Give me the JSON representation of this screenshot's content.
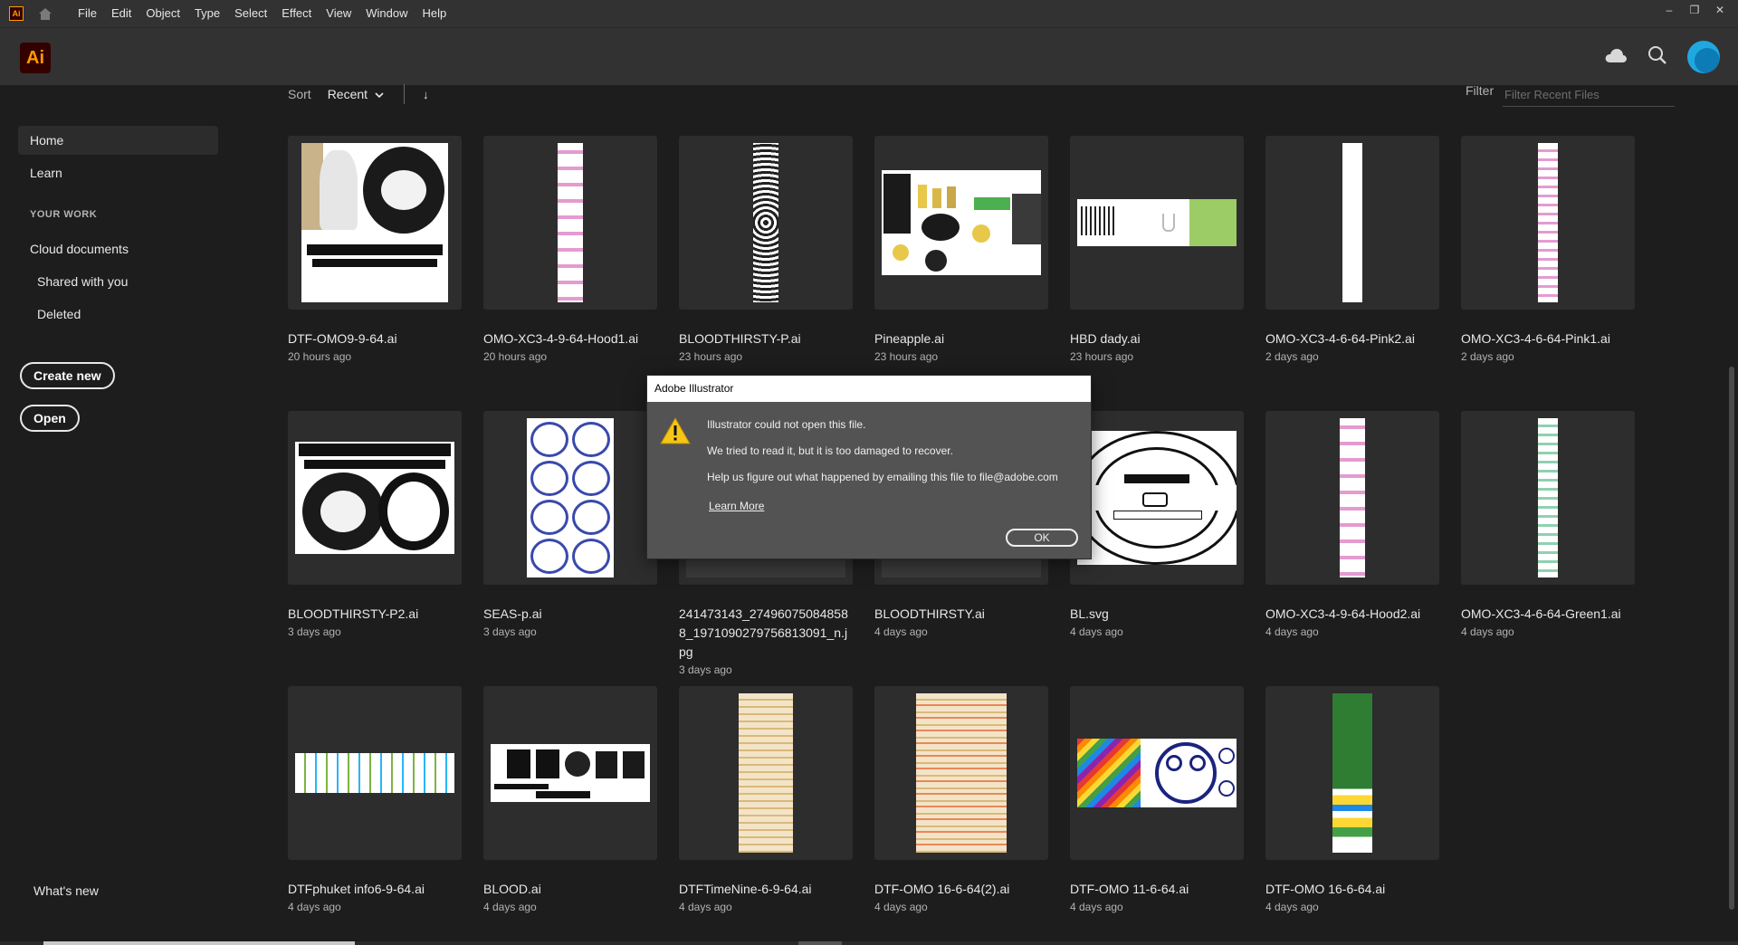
{
  "menubar": {
    "logo_text": "Ai",
    "items": [
      "File",
      "Edit",
      "Object",
      "Type",
      "Select",
      "Effect",
      "View",
      "Window",
      "Help"
    ]
  },
  "window_controls": [
    "–",
    "❐",
    "✕"
  ],
  "appbar": {
    "logo_text": "Ai"
  },
  "sidebar": {
    "home": "Home",
    "learn": "Learn",
    "your_work": "YOUR WORK",
    "cloud_documents": "Cloud documents",
    "shared_with_you": "Shared with you",
    "deleted": "Deleted",
    "create_new": "Create new",
    "open": "Open",
    "whats_new": "What's new"
  },
  "toolbar": {
    "sort_label": "Sort",
    "sort_value": "Recent",
    "sort_direction_icon": "↓",
    "filter_label": "Filter",
    "filter_placeholder": "Filter Recent Files"
  },
  "files": [
    {
      "name": "DTF-OMO9-9-64.ai",
      "date": "20 hours ago"
    },
    {
      "name": "OMO-XC3-4-9-64-Hood1.ai",
      "date": "20 hours ago"
    },
    {
      "name": "BLOODTHIRSTY-P.ai",
      "date": "23 hours ago"
    },
    {
      "name": "Pineapple.ai",
      "date": "23 hours ago"
    },
    {
      "name": "HBD dady.ai",
      "date": "23 hours ago"
    },
    {
      "name": "OMO-XC3-4-6-64-Pink2.ai",
      "date": "2 days ago"
    },
    {
      "name": "OMO-XC3-4-6-64-Pink1.ai",
      "date": "2 days ago"
    },
    {
      "name": "BLOODTHIRSTY-P2.ai",
      "date": "3 days ago"
    },
    {
      "name": "SEAS-p.ai",
      "date": "3 days ago"
    },
    {
      "name": "241473143_274960750848588_1971090279756813091_n.jpg",
      "date": "3 days ago"
    },
    {
      "name": "BLOODTHIRSTY.ai",
      "date": "4 days ago"
    },
    {
      "name": "BL.svg",
      "date": "4 days ago"
    },
    {
      "name": "OMO-XC3-4-9-64-Hood2.ai",
      "date": "4 days ago"
    },
    {
      "name": "OMO-XC3-4-6-64-Green1.ai",
      "date": "4 days ago"
    },
    {
      "name": "DTFphuket info6-9-64.ai",
      "date": "4 days ago"
    },
    {
      "name": "BLOOD.ai",
      "date": "4 days ago"
    },
    {
      "name": "DTFTimeNine-6-9-64.ai",
      "date": "4 days ago"
    },
    {
      "name": "DTF-OMO 16-6-64(2).ai",
      "date": "4 days ago"
    },
    {
      "name": "DTF-OMO 11-6-64.ai",
      "date": "4 days ago"
    },
    {
      "name": "DTF-OMO 16-6-64.ai",
      "date": "4 days ago"
    }
  ],
  "dialog": {
    "title": "Adobe Illustrator",
    "line1": "Illustrator could not open this file.",
    "line2": "We tried to read it, but it is too damaged to recover.",
    "line3": "Help us figure out what happened by emailing this file to file@adobe.com",
    "link": "Learn More",
    "ok": "OK"
  },
  "colors": {
    "accent_orange": "#ff9a00",
    "logo_bg": "#330000",
    "avatar": "#1fa8e0"
  }
}
